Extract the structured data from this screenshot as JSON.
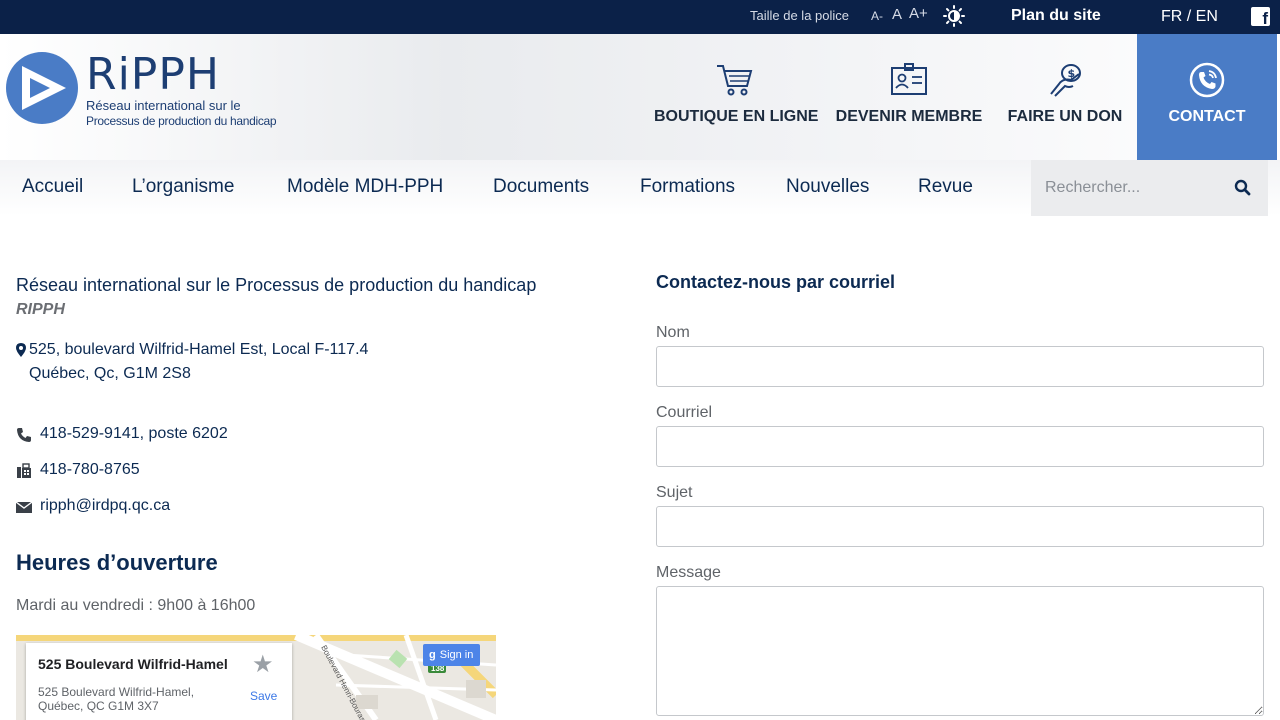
{
  "topbar": {
    "font_size_label": "Taille de la police",
    "font_decrease": "A-",
    "font_normal": "A",
    "font_increase": "A+",
    "sitemap": "Plan du site",
    "languages": "FR / EN",
    "facebook": "f"
  },
  "logo": {
    "title": "RiPPH",
    "line1": "Réseau international sur le",
    "line2": "Processus de production du handicap"
  },
  "quick_links": {
    "shop": "BOUTIQUE EN LIGNE",
    "member": "DEVENIR MEMBRE",
    "donate": "FAIRE UN DON",
    "contact": "CONTACT"
  },
  "nav": {
    "items": [
      "Accueil",
      "L’organisme",
      "Modèle MDH-PPH",
      "Documents",
      "Formations",
      "Nouvelles",
      "Revue"
    ],
    "search_placeholder": "Rechercher..."
  },
  "contact_info": {
    "org_name": "Réseau international sur le Processus de production du handicap",
    "org_abbr": "RIPPH",
    "address_line1": "525, boulevard Wilfrid-Hamel Est, Local F-117.4",
    "address_line2": "Québec, Qc, G1M 2S8",
    "phone": "418-529-9141, poste 6202",
    "fax": "418-780-8765",
    "email": "ripph@irdpq.qc.ca"
  },
  "hours": {
    "title": "Heures d’ouverture",
    "text": "Mardi au vendredi : 9h00 à 16h00"
  },
  "map": {
    "place_name": "525 Boulevard Wilfrid-Hamel",
    "address_line1": "525 Boulevard Wilfrid-Hamel,",
    "address_line2": "Québec, QC G1M 3X7",
    "save_label": "Save",
    "signin_label": "Sign in",
    "road_label": "Boulevard Henri-Bourassa",
    "route_number": "138"
  },
  "form": {
    "title": "Contactez-nous par courriel",
    "name_label": "Nom",
    "email_label": "Courriel",
    "subject_label": "Sujet",
    "message_label": "Message",
    "name_value": "",
    "email_value": "",
    "subject_value": "",
    "message_value": ""
  },
  "colors": {
    "topbar_bg": "#0b2148",
    "brand_blue": "#4a7cc6",
    "text_dark": "#0c2a52"
  }
}
